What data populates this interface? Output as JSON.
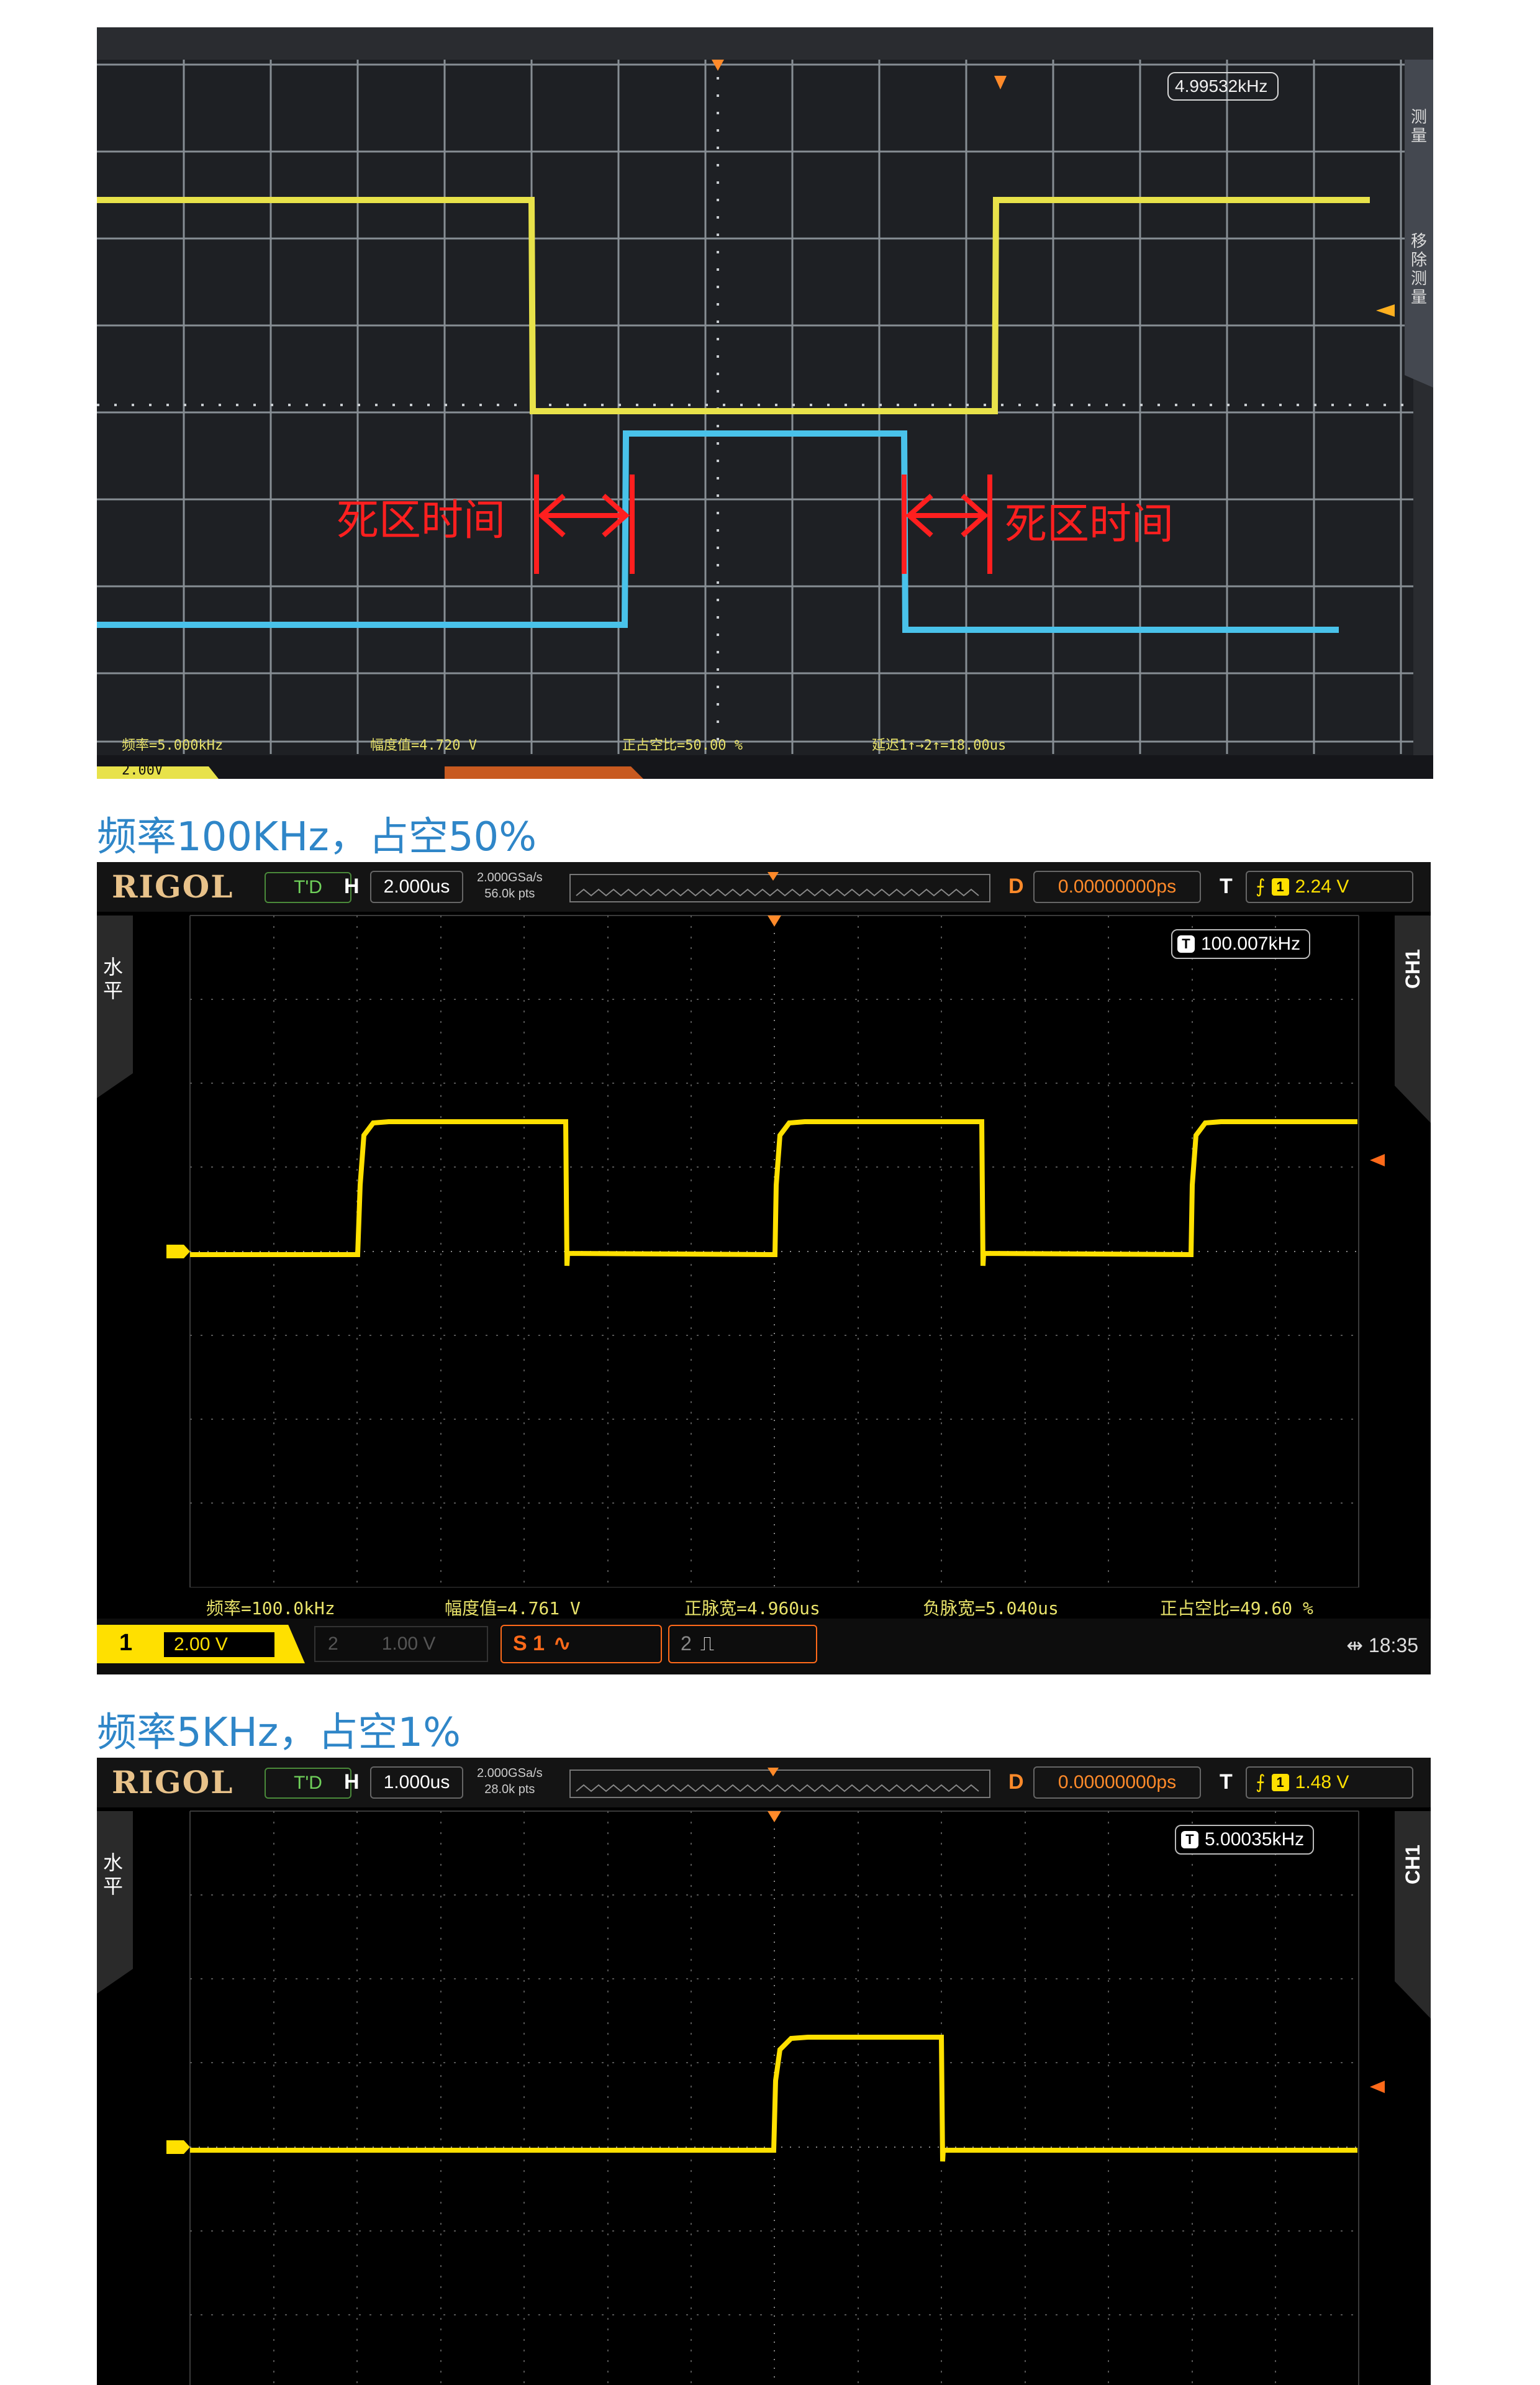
{
  "photo": {
    "frequency": "4.99532kHz",
    "annotation_left": "死区时间",
    "annotation_right": "死区时间",
    "meas_freq": "频率=5.000kHz",
    "meas_amp": "幅度值=4.720 V",
    "meas_duty": "正占空比=50.00 %",
    "meas_delay": "延迟1↑→2↑=18.00us",
    "bottom_ch1": "2.00V",
    "side_text": "测量",
    "side_text2": "移除测量"
  },
  "heading1": "频率100KHz，占空50%",
  "heading2": "频率5KHz，占空1%",
  "scope1": {
    "logo": "RIGOL",
    "run_state": "T'D",
    "h_label": "H",
    "timebase": "2.000us",
    "sample_rate": "2.000GSa/s",
    "mem_depth": "56.0k pts",
    "d_label": "D",
    "delay": "0.00000000ps",
    "t_label": "T",
    "trigger_level": "2.24 V",
    "frequency": "100.007kHz",
    "side_left": "水平",
    "side_right": "CH1",
    "meas_freq": "频率=100.0kHz",
    "meas_amp": "幅度值=4.761  V",
    "meas_pwidth": "正脉宽=4.960us",
    "meas_nwidth": "负脉宽=5.040us",
    "meas_duty": "正占空比=49.60 %",
    "ch1_num": "1",
    "ch1_scale": "2.00 V",
    "ch2_num": "2",
    "ch2_scale": "1.00 V",
    "s1_label": "S 1",
    "s2_label": "2",
    "time": "18:35"
  },
  "scope2": {
    "logo": "RIGOL",
    "run_state": "T'D",
    "h_label": "H",
    "timebase": "1.000us",
    "sample_rate": "2.000GSa/s",
    "mem_depth": "28.0k pts",
    "d_label": "D",
    "delay": "0.00000000ps",
    "t_label": "T",
    "trigger_level": "1.48 V",
    "frequency": "5.00035kHz",
    "side_left": "水平",
    "side_right": "CH1"
  },
  "colors": {
    "trace_yellow": "#ffe000",
    "trace_cyan": "#3fc4f2",
    "heading_blue": "#2f86c8",
    "annotation_red": "#ff1f1f"
  }
}
